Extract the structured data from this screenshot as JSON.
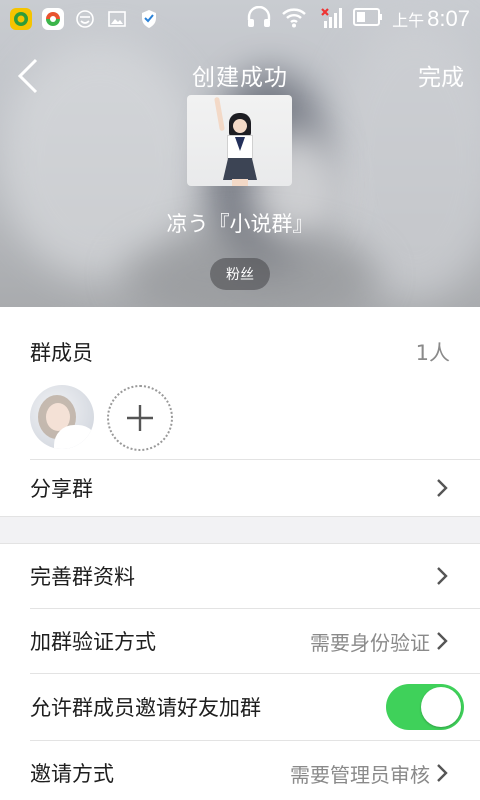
{
  "status_bar": {
    "apps": [
      "wechat-like-app-icon",
      "market-app-icon",
      "smiley-app-icon",
      "gallery-icon",
      "shield-app-icon"
    ],
    "am_pm": "上午",
    "time": "8:07"
  },
  "nav": {
    "title": "创建成功",
    "done_label": "完成"
  },
  "group": {
    "name": "凉う『小说群』",
    "tag": "粉丝"
  },
  "members": {
    "label": "群成员",
    "count": "1人"
  },
  "rows": {
    "share": {
      "label": "分享群"
    },
    "complete_info": {
      "label": "完善群资料"
    },
    "join_verify": {
      "label": "加群验证方式",
      "value": "需要身份验证"
    },
    "allow_invite": {
      "label": "允许群成员邀请好友加群",
      "enabled": true
    },
    "invite_method": {
      "label": "邀请方式",
      "value": "需要管理员审核"
    }
  },
  "colors": {
    "toggle_on": "#3fd15a",
    "secondary_text": "#8a8a8a",
    "divider": "#e3e3e3"
  }
}
